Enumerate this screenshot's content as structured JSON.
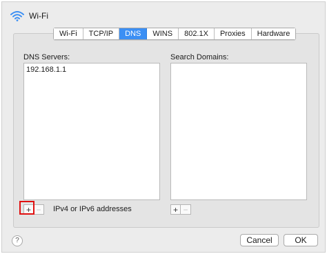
{
  "window": {
    "title": "Wi-Fi",
    "icon": "wifi-icon"
  },
  "tabs": [
    {
      "label": "Wi-Fi",
      "active": false
    },
    {
      "label": "TCP/IP",
      "active": false
    },
    {
      "label": "DNS",
      "active": true
    },
    {
      "label": "WINS",
      "active": false
    },
    {
      "label": "802.1X",
      "active": false
    },
    {
      "label": "Proxies",
      "active": false
    },
    {
      "label": "Hardware",
      "active": false
    }
  ],
  "dns": {
    "servers_label": "DNS Servers:",
    "servers": [
      "192.168.1.1"
    ],
    "domains_label": "Search Domains:",
    "domains": [],
    "hint": "IPv4 or IPv6 addresses",
    "add_symbol": "+",
    "remove_symbol": "−"
  },
  "footer": {
    "help": "?",
    "cancel": "Cancel",
    "ok": "OK"
  },
  "colors": {
    "accent": "#3b8ff4",
    "highlight": "#e01010"
  }
}
